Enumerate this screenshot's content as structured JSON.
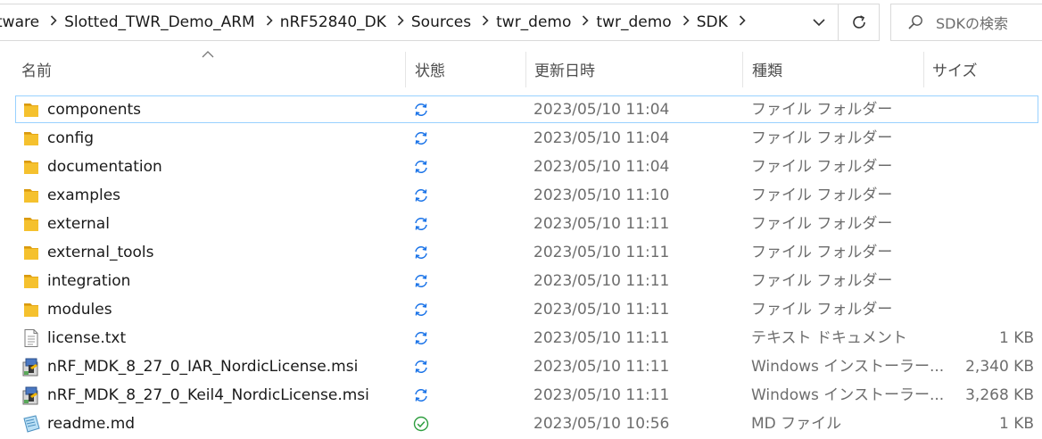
{
  "breadcrumb": [
    {
      "label": "tware"
    },
    {
      "label": "Slotted_TWR_Demo_ARM"
    },
    {
      "label": "nRF52840_DK"
    },
    {
      "label": "Sources"
    },
    {
      "label": "twr_demo"
    },
    {
      "label": "twr_demo"
    },
    {
      "label": "SDK"
    }
  ],
  "search": {
    "placeholder": "SDKの検索"
  },
  "columns": {
    "name": "名前",
    "status": "状態",
    "date": "更新日時",
    "type": "種類",
    "size": "サイズ"
  },
  "colors": {
    "sync": "#1a73e8",
    "ok": "#2e9e3f",
    "folder": "#f5c12e",
    "selection_border": "#99d1ff"
  },
  "rows": [
    {
      "name": "components",
      "icon": "folder-icon",
      "status": "sync",
      "date": "2023/05/10 11:04",
      "type": "ファイル フォルダー",
      "size": "",
      "selected": true
    },
    {
      "name": "config",
      "icon": "folder-icon",
      "status": "sync",
      "date": "2023/05/10 11:04",
      "type": "ファイル フォルダー",
      "size": ""
    },
    {
      "name": "documentation",
      "icon": "folder-icon",
      "status": "sync",
      "date": "2023/05/10 11:04",
      "type": "ファイル フォルダー",
      "size": ""
    },
    {
      "name": "examples",
      "icon": "folder-icon",
      "status": "sync",
      "date": "2023/05/10 11:10",
      "type": "ファイル フォルダー",
      "size": ""
    },
    {
      "name": "external",
      "icon": "folder-icon",
      "status": "sync",
      "date": "2023/05/10 11:11",
      "type": "ファイル フォルダー",
      "size": ""
    },
    {
      "name": "external_tools",
      "icon": "folder-icon",
      "status": "sync",
      "date": "2023/05/10 11:11",
      "type": "ファイル フォルダー",
      "size": ""
    },
    {
      "name": "integration",
      "icon": "folder-icon",
      "status": "sync",
      "date": "2023/05/10 11:11",
      "type": "ファイル フォルダー",
      "size": ""
    },
    {
      "name": "modules",
      "icon": "folder-icon",
      "status": "sync",
      "date": "2023/05/10 11:11",
      "type": "ファイル フォルダー",
      "size": ""
    },
    {
      "name": "license.txt",
      "icon": "text-file-icon",
      "status": "sync",
      "date": "2023/05/10 11:11",
      "type": "テキスト ドキュメント",
      "size": "1 KB"
    },
    {
      "name": "nRF_MDK_8_27_0_IAR_NordicLicense.msi",
      "icon": "installer-icon",
      "status": "sync",
      "date": "2023/05/10 11:11",
      "type": "Windows インストーラー...",
      "size": "2,340 KB"
    },
    {
      "name": "nRF_MDK_8_27_0_Keil4_NordicLicense.msi",
      "icon": "installer-icon",
      "status": "sync",
      "date": "2023/05/10 11:11",
      "type": "Windows インストーラー...",
      "size": "3,268 KB"
    },
    {
      "name": "readme.md",
      "icon": "markdown-file-icon",
      "status": "ok",
      "date": "2023/05/10 10:56",
      "type": "MD ファイル",
      "size": "1 KB"
    }
  ]
}
